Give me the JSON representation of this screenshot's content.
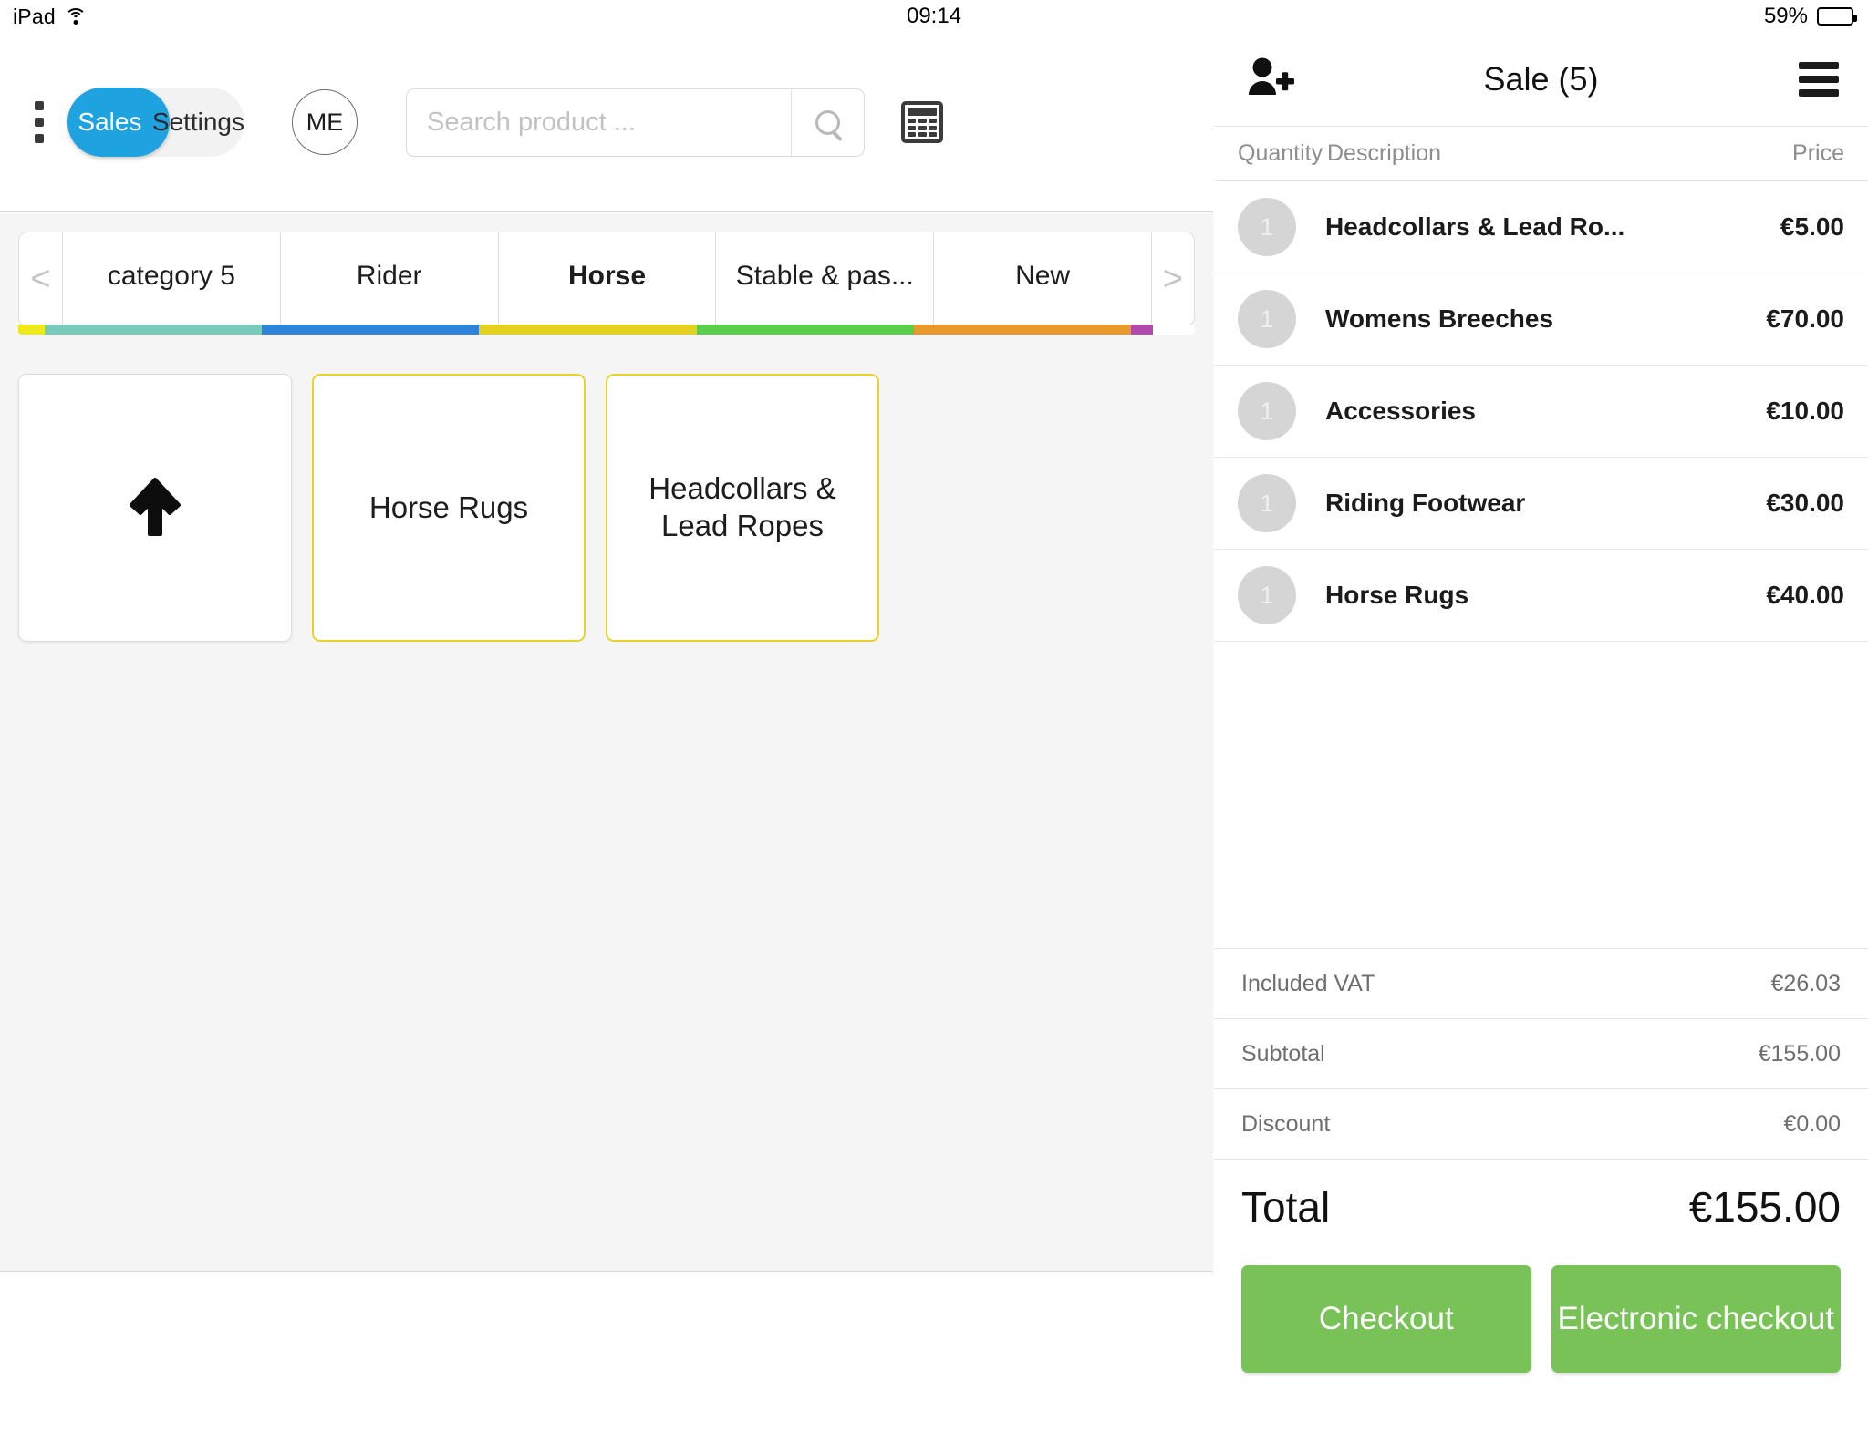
{
  "status_bar": {
    "device": "iPad",
    "wifi_icon": "wifi-icon",
    "time": "09:14",
    "location_icon": "location-arrow-icon",
    "battery_percent": "59%",
    "battery_level": 59
  },
  "toolbar": {
    "menu_icon": "kebab-menu-icon",
    "segments": [
      {
        "label": "Sales",
        "active": true
      },
      {
        "label": "Settings",
        "active": false
      }
    ],
    "avatar_initials": "ME",
    "search": {
      "placeholder": "Search product ...",
      "value": "",
      "icon": "search-icon"
    },
    "calculator_icon": "calculator-icon"
  },
  "categories": {
    "prev_arrow": "<",
    "next_arrow": ">",
    "tabs": [
      {
        "label": "category 5",
        "active": false,
        "color": "#76cbbb"
      },
      {
        "label": "Rider",
        "active": false,
        "color": "#2d84d8"
      },
      {
        "label": "Horse",
        "active": true,
        "color": "#e4d01f"
      },
      {
        "label": "Stable & pas...",
        "active": false,
        "color": "#5ace4b"
      },
      {
        "label": "New",
        "active": false,
        "color": "#e79a2b"
      }
    ],
    "strip_lead_color": "#f0e91a",
    "strip_tail_color": "#b24aad"
  },
  "product_grid": {
    "back_tile_icon": "up-arrow-icon",
    "tiles": [
      {
        "label": "Horse Rugs",
        "type": "category",
        "accent": "#e8d32a"
      },
      {
        "label": "Headcollars & Lead Ropes",
        "type": "category",
        "accent": "#e8d32a"
      }
    ]
  },
  "cart": {
    "add_customer_icon": "add-user-icon",
    "title": "Sale (5)",
    "menu_icon": "hamburger-menu-icon",
    "columns": {
      "quantity": "Quantity",
      "description": "Description",
      "price": "Price"
    },
    "items": [
      {
        "qty": "1",
        "description": "Headcollars & Lead Ro...",
        "price": "€5.00"
      },
      {
        "qty": "1",
        "description": "Womens Breeches",
        "price": "€70.00"
      },
      {
        "qty": "1",
        "description": "Accessories",
        "price": "€10.00"
      },
      {
        "qty": "1",
        "description": "Riding Footwear",
        "price": "€30.00"
      },
      {
        "qty": "1",
        "description": "Horse Rugs",
        "price": "€40.00"
      }
    ],
    "totals": [
      {
        "label": "Included VAT",
        "value": "€26.03"
      },
      {
        "label": "Subtotal",
        "value": "€155.00"
      },
      {
        "label": "Discount",
        "value": "€0.00"
      }
    ],
    "grand_total": {
      "label": "Total",
      "value": "€155.00"
    },
    "actions": [
      {
        "label": "Checkout",
        "color": "#78c257"
      },
      {
        "label": "Electronic checkout",
        "color": "#78c257"
      }
    ]
  },
  "theme": {
    "accent_blue": "#1fa2e0",
    "action_green": "#78c257",
    "panel_bg": "#f5f5f5"
  }
}
